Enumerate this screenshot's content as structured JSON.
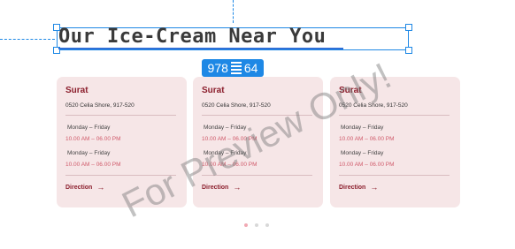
{
  "heading": {
    "title": "Our Ice-Cream Near You"
  },
  "selection_size": {
    "width": "978",
    "height": "64"
  },
  "cards": [
    {
      "city": "Surat",
      "address": "0520 Celia Shore, 917-520",
      "day1": "Monday – Friday",
      "time1": "10.00 AM – 06.00 PM",
      "day2": "Monday – Friday",
      "time2": "10.00 AM – 06.00 PM",
      "link": "Direction"
    },
    {
      "city": "Surat",
      "address": "0520 Celia Shore, 917-520",
      "day1": "Monday – Friday",
      "time1": "10.00 AM – 06.00 PM",
      "day2": "Monday – Friday",
      "time2": "10.00 AM – 06.00 PM",
      "link": "Direction"
    },
    {
      "city": "Surat",
      "address": "0520 Celia Shore, 917-520",
      "day1": "Monday – Friday",
      "time1": "10.00 AM – 06.00 PM",
      "day2": "Monday – Friday",
      "time2": "10.00 AM – 06.00 PM",
      "link": "Direction"
    }
  ],
  "pagination": {
    "count": 3,
    "active": 1
  },
  "watermark": "For Preview Only!",
  "colors": {
    "accent": "#8b1e2c",
    "card_bg": "#f6e6e7",
    "time": "#d05b6b",
    "selection": "#1e88e5"
  }
}
